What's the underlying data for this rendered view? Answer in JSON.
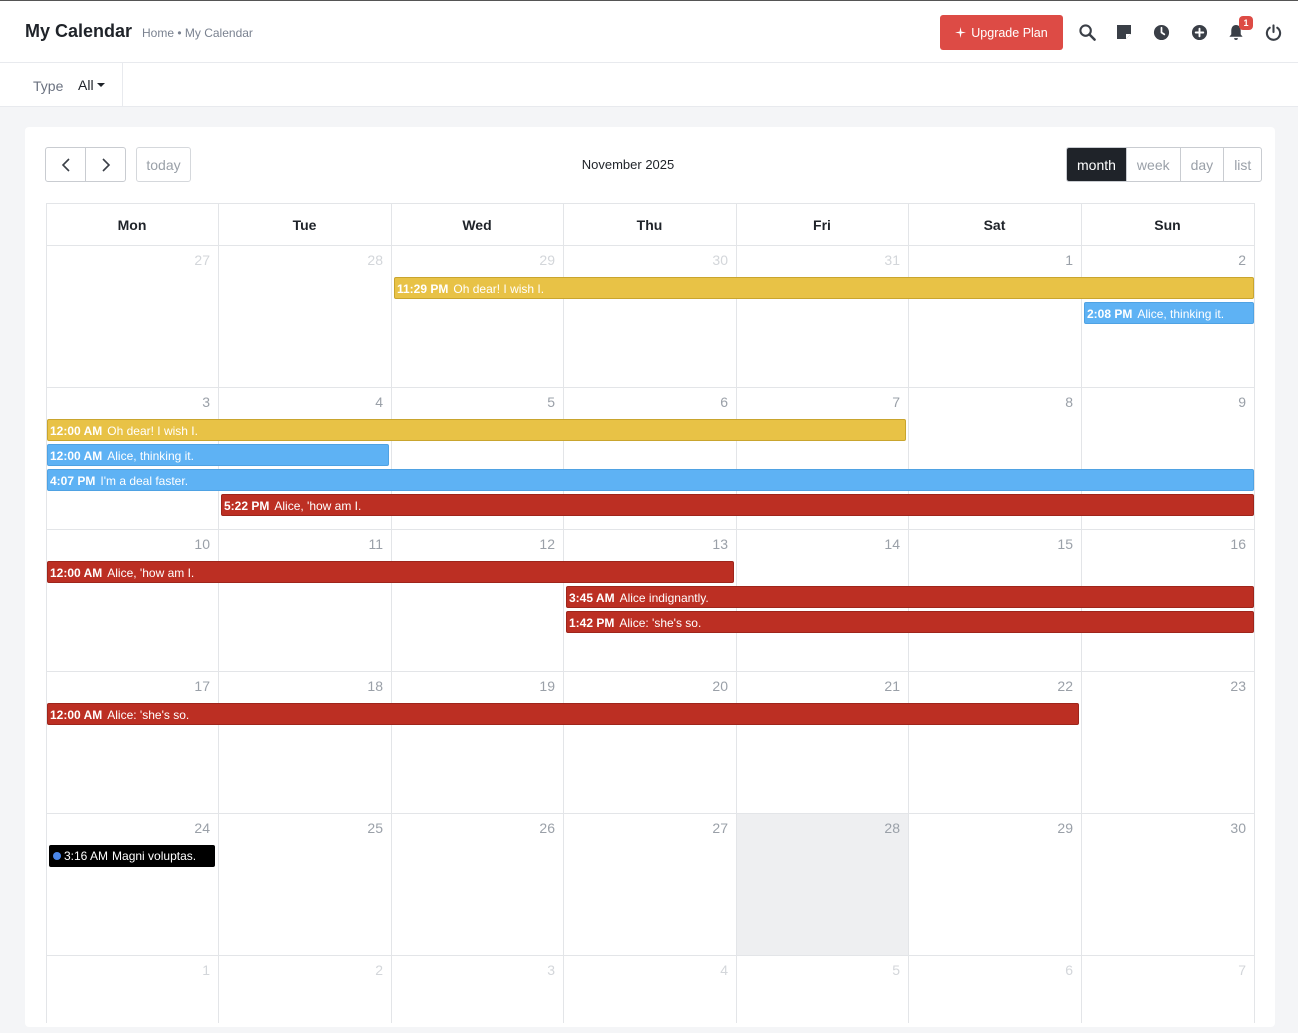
{
  "header": {
    "title": "My Calendar",
    "breadcrumb": "Home • My Calendar",
    "upgrade_label": "Upgrade Plan",
    "notification_count": "1",
    "icons": [
      "search-icon",
      "note-icon",
      "clock-icon",
      "plus-circle-icon",
      "bell-icon",
      "power-icon"
    ]
  },
  "filter": {
    "label": "Type",
    "value": "All"
  },
  "calendar": {
    "title": "November 2025",
    "today_label": "today",
    "views": [
      "month",
      "week",
      "day",
      "list"
    ],
    "active_view": "month",
    "days_of_week": [
      "Mon",
      "Tue",
      "Wed",
      "Thu",
      "Fri",
      "Sat",
      "Sun"
    ],
    "weeks": [
      [
        {
          "d": "27",
          "other": true
        },
        {
          "d": "28",
          "other": true
        },
        {
          "d": "29",
          "other": true
        },
        {
          "d": "30",
          "other": true
        },
        {
          "d": "31",
          "other": true
        },
        {
          "d": "1"
        },
        {
          "d": "2"
        }
      ],
      [
        {
          "d": "3"
        },
        {
          "d": "4"
        },
        {
          "d": "5"
        },
        {
          "d": "6"
        },
        {
          "d": "7"
        },
        {
          "d": "8"
        },
        {
          "d": "9"
        }
      ],
      [
        {
          "d": "10"
        },
        {
          "d": "11"
        },
        {
          "d": "12"
        },
        {
          "d": "13"
        },
        {
          "d": "14"
        },
        {
          "d": "15"
        },
        {
          "d": "16"
        }
      ],
      [
        {
          "d": "17"
        },
        {
          "d": "18"
        },
        {
          "d": "19"
        },
        {
          "d": "20"
        },
        {
          "d": "21"
        },
        {
          "d": "22"
        },
        {
          "d": "23"
        }
      ],
      [
        {
          "d": "24"
        },
        {
          "d": "25"
        },
        {
          "d": "26"
        },
        {
          "d": "27"
        },
        {
          "d": "28",
          "highlight": true
        },
        {
          "d": "29"
        },
        {
          "d": "30"
        }
      ],
      [
        {
          "d": "1",
          "other": true
        },
        {
          "d": "2",
          "other": true
        },
        {
          "d": "3",
          "other": true
        },
        {
          "d": "4",
          "other": true
        },
        {
          "d": "5",
          "other": true
        },
        {
          "d": "6",
          "other": true
        },
        {
          "d": "7",
          "other": true
        }
      ]
    ],
    "events": [
      {
        "time": "11:29 PM",
        "title": "Oh dear! I wish I.",
        "color": "yellow",
        "week": 0,
        "start": 2,
        "end": 6,
        "row": 0
      },
      {
        "time": "2:08 PM",
        "title": "Alice, thinking it.",
        "color": "blue",
        "week": 0,
        "start": 6,
        "end": 6,
        "row": 1
      },
      {
        "time": "12:00 AM",
        "title": "Oh dear! I wish I.",
        "color": "yellow",
        "week": 1,
        "start": 0,
        "end": 4,
        "row": 0
      },
      {
        "time": "12:00 AM",
        "title": "Alice, thinking it.",
        "color": "blue",
        "week": 1,
        "start": 0,
        "end": 1,
        "row": 1
      },
      {
        "time": "4:07 PM",
        "title": "I'm a deal faster.",
        "color": "blue",
        "week": 1,
        "start": 0,
        "end": 6,
        "row": 2
      },
      {
        "time": "5:22 PM",
        "title": "Alice, 'how am I.",
        "color": "red",
        "week": 1,
        "start": 1,
        "end": 6,
        "row": 3
      },
      {
        "time": "12:00 AM",
        "title": "Alice, 'how am I.",
        "color": "red",
        "week": 2,
        "start": 0,
        "end": 3,
        "row": 0
      },
      {
        "time": "3:45 AM",
        "title": "Alice indignantly.",
        "color": "red",
        "week": 2,
        "start": 3,
        "end": 6,
        "row": 1
      },
      {
        "time": "1:42 PM",
        "title": "Alice: 'she's so.",
        "color": "red",
        "week": 2,
        "start": 3,
        "end": 6,
        "row": 2
      },
      {
        "time": "12:00 AM",
        "title": "Alice: 'she's so.",
        "color": "red",
        "week": 3,
        "start": 0,
        "end": 5,
        "row": 0
      },
      {
        "time": "3:16 AM",
        "title": "Magni voluptas.",
        "color": "black",
        "week": 4,
        "start": 0,
        "end": 0,
        "row": 0
      }
    ]
  }
}
